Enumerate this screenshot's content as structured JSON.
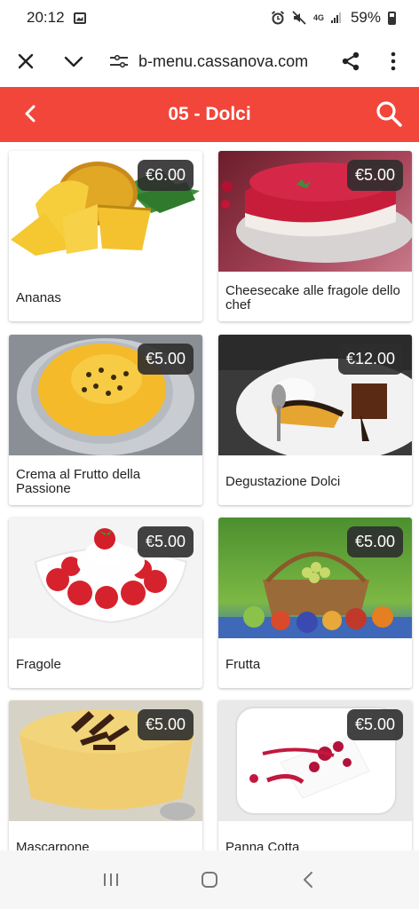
{
  "status": {
    "time": "20:12",
    "network": "4G",
    "battery": "59%"
  },
  "browser": {
    "url": "b-menu.cassanova.com"
  },
  "header": {
    "title": "05 - Dolci"
  },
  "products": [
    {
      "name": "Ananas",
      "price": "€6.00",
      "image": "pineapple"
    },
    {
      "name": "Cheesecake alle fragole dello chef",
      "price": "€5.00",
      "image": "cheesecake"
    },
    {
      "name": "Crema al Frutto della Passione",
      "price": "€5.00",
      "image": "passion-fruit-cream"
    },
    {
      "name": "Degustazione Dolci",
      "price": "€12.00",
      "image": "dessert-platter"
    },
    {
      "name": "Fragole",
      "price": "€5.00",
      "image": "strawberries-cream"
    },
    {
      "name": "Frutta",
      "price": "€5.00",
      "image": "fruit-basket"
    },
    {
      "name": "Mascarpone",
      "price": "€5.00",
      "image": "mascarpone"
    },
    {
      "name": "Panna Cotta",
      "price": "€5.00",
      "image": "panna-cotta"
    }
  ],
  "colors": {
    "accent": "#f2463a"
  }
}
